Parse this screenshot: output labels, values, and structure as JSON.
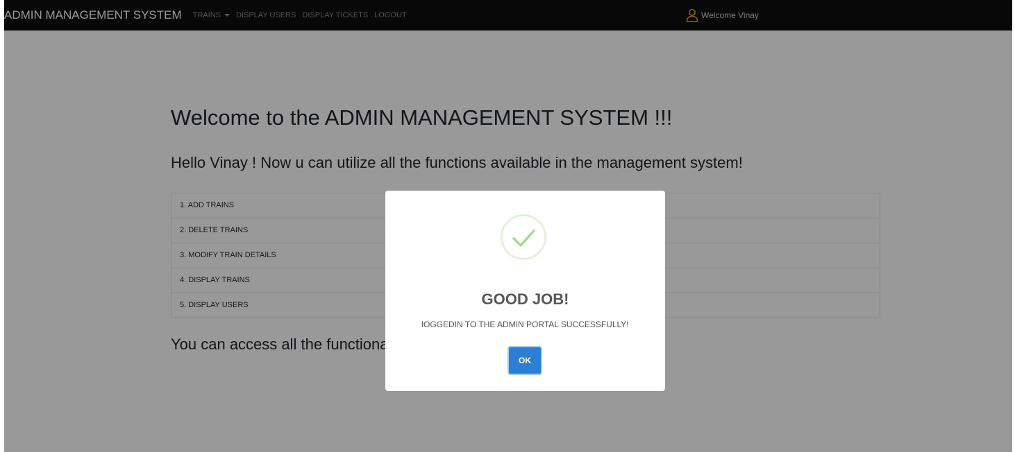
{
  "navbar": {
    "brand": "ADMIN MANAGEMENT SYSTEM",
    "links": {
      "trains": "TRAINS",
      "display_users": "DISPLAY USERS",
      "display_tickets": "DISPLAY TICKETS",
      "logout": "LOGOUT"
    },
    "welcome": "Welcome Vinay",
    "user_icon": "user-icon"
  },
  "main": {
    "title": "Welcome to the ADMIN MANAGEMENT SYSTEM !!!",
    "subtitle": "Hello Vinay ! Now u can utilize all the functions available in the management system!",
    "functions": [
      "1. ADD TRAINS",
      "2. DELETE TRAINS",
      "3. MODIFY TRAIN DETAILS",
      "4. DISPLAY TRAINS",
      "5. DISPLAY USERS"
    ],
    "access_text": "You can access all the functiona"
  },
  "modal": {
    "icon": "success-check-icon",
    "title": "GOOD JOB!",
    "text": "lOGGEDIN TO THE ADMIN PORTAL SUCCESSFULLY!",
    "ok_label": "OK"
  },
  "colors": {
    "navbar_bg": "#0e0e0e",
    "overlay": "rgba(0,0,0,0.4)",
    "ok_button": "#2b7fd5",
    "check_green": "#a5dc86"
  }
}
